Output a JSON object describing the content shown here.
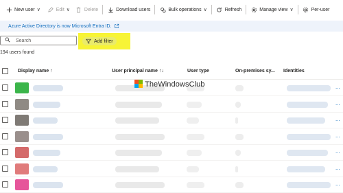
{
  "toolbar": {
    "new_user": "New user",
    "edit": "Edit",
    "delete": "Delete",
    "download_users": "Download users",
    "bulk_operations": "Bulk operations",
    "refresh": "Refresh",
    "manage_view": "Manage view",
    "per_user": "Per-user"
  },
  "banner": {
    "text": "Azure Active Directory is now Microsoft Entra ID."
  },
  "search": {
    "placeholder": "Search"
  },
  "filter": {
    "label": "Add filter"
  },
  "count_text": "194 users found",
  "table": {
    "headers": {
      "display_name": "Display name ↑",
      "upn": "User principal name ↑↓",
      "user_type": "User type",
      "onprem": "On-premises sy...",
      "identities": "Identities"
    },
    "rows": [
      {
        "avatar_color": "#3bb54a"
      },
      {
        "avatar_color": "#8f8a84"
      },
      {
        "avatar_color": "#7f7a75"
      },
      {
        "avatar_color": "#9a8f8c"
      },
      {
        "avatar_color": "#d46a6a"
      },
      {
        "avatar_color": "#e07b7b"
      },
      {
        "avatar_color": "#e6559a"
      }
    ]
  },
  "watermark": {
    "text": "TheWindowsClub"
  },
  "colors": {
    "accent": "#0f6cbd",
    "highlight": "#f7f436"
  }
}
